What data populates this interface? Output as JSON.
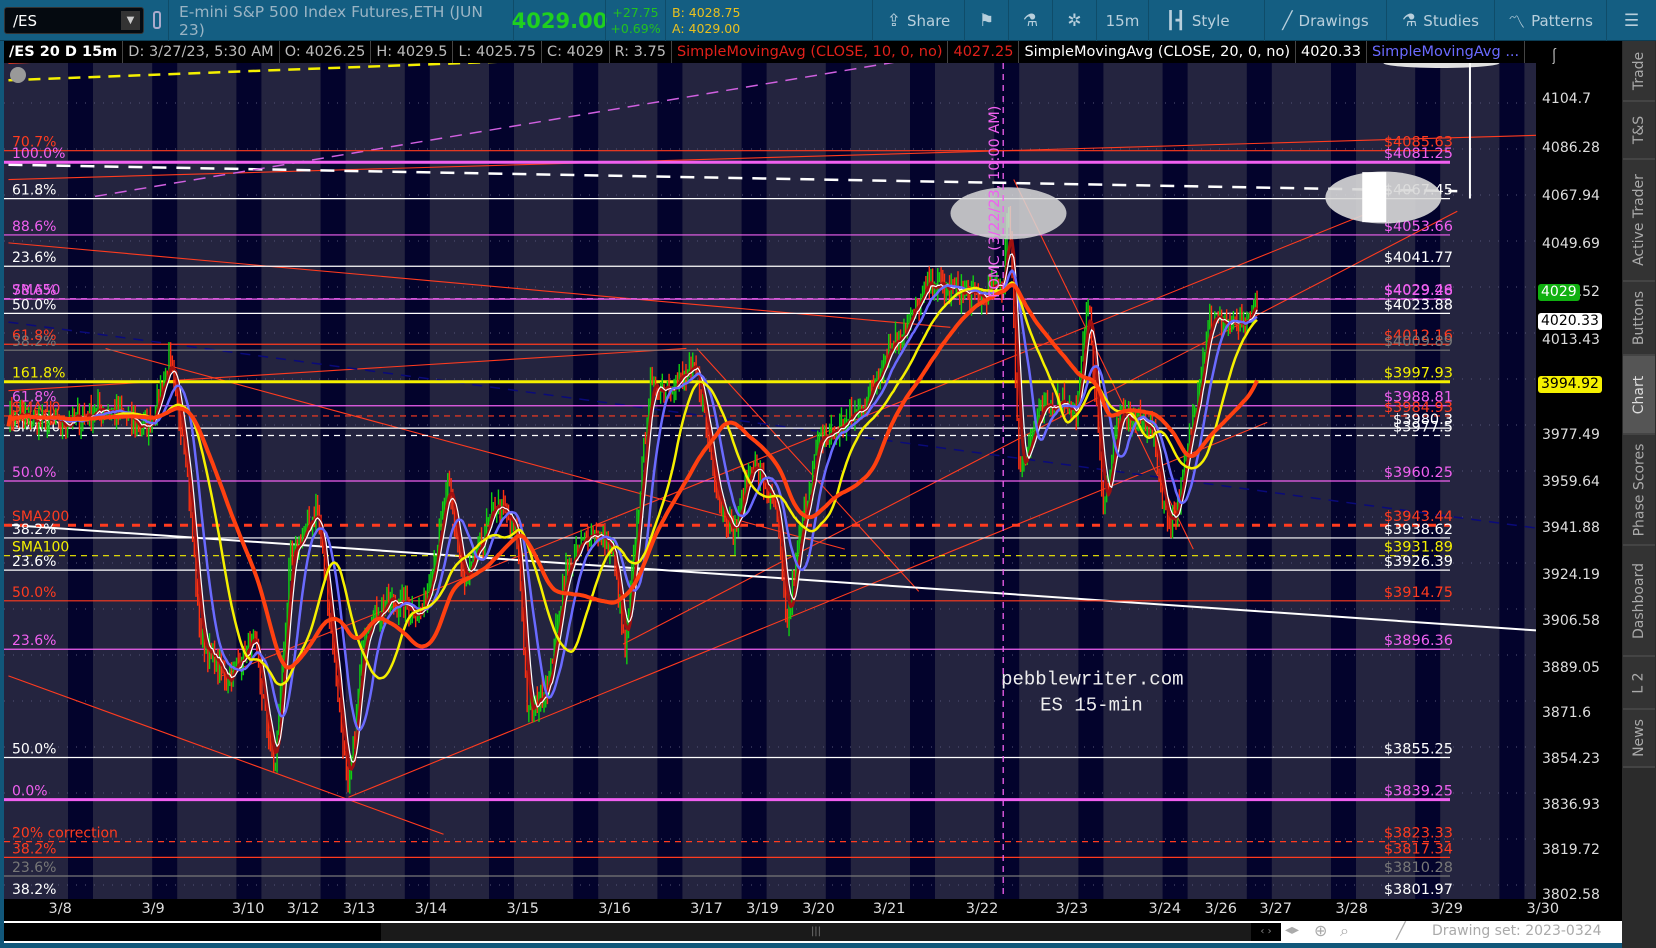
{
  "toolbar": {
    "symbol": "/ES",
    "description": "E-mini S&P 500 Index Futures,ETH (JUN 23)",
    "last": "4029.00",
    "change": "+27.75",
    "change_pct": "+0.69%",
    "bid": "B: 4028.75",
    "ask": "A: 4029.00",
    "buttons": [
      {
        "label": "Share",
        "icon": "share-icon"
      },
      {
        "label": "",
        "icon": "alert-icon"
      },
      {
        "label": "",
        "icon": "flask-icon"
      },
      {
        "label": "",
        "icon": "gear-icon"
      },
      {
        "label": "15m",
        "icon": ""
      },
      {
        "label": "Style",
        "icon": "candle-icon"
      },
      {
        "label": "Drawings",
        "icon": "pencil-line-icon"
      },
      {
        "label": "Studies",
        "icon": "flask-icon"
      },
      {
        "label": "Patterns",
        "icon": "patterns-icon"
      },
      {
        "label": "",
        "icon": "menu-icon"
      }
    ]
  },
  "info": {
    "title": "/ES 20 D 15m",
    "date": "D: 3/27/23, 5:30 AM",
    "open": "O: 4026.25",
    "high": "H: 4029.5",
    "low": "L: 4025.75",
    "close": "C: 4029",
    "range": "R: 3.75",
    "study1": "SimpleMovingAvg (CLOSE, 10, 0, no)",
    "study1_value": "4027.25",
    "study2": "SimpleMovingAvg (CLOSE, 20, 0, no)",
    "study2_value": "4020.33",
    "study3": "SimpleMovingAvg ...",
    "colors": {
      "study1": "#e0201a",
      "study2": "#ffffff",
      "study3": "#6a6aff"
    }
  },
  "levels": [
    {
      "price": 4085.63,
      "left": "70.7%",
      "right": "$4085.63",
      "color": "#ff3b1f",
      "style": "solid"
    },
    {
      "price": 4081.25,
      "left": "100.0%",
      "right": "$4081.25",
      "color": "#f060f0",
      "style": "thick"
    },
    {
      "price": 4067.45,
      "left": "61.8%",
      "right": "$4067.45",
      "color": "#ffffff",
      "style": "solid"
    },
    {
      "price": 4053.66,
      "left": "88.6%",
      "right": "$4053.66",
      "color": "#f060f0",
      "style": "solid"
    },
    {
      "price": 4041.77,
      "left": "23.6%",
      "right": "$4041.77",
      "color": "#ffffff",
      "style": "solid"
    },
    {
      "price": 4029.46,
      "left": "SMA50",
      "right": "$4029.46",
      "color": "#f060f0",
      "style": "dashed"
    },
    {
      "price": 4029.28,
      "left": "78.6%",
      "right": "$4029.28",
      "color": "#f060f0",
      "style": "solid"
    },
    {
      "price": 4023.88,
      "left": "50.0%",
      "right": "$4023.88",
      "color": "#ffffff",
      "style": "solid"
    },
    {
      "price": 4012.16,
      "left": "61.8%",
      "right": "$4012.16",
      "color": "#ff3b1f",
      "style": "solid"
    },
    {
      "price": 4009.89,
      "left": "38.2%",
      "right": "$4009.89",
      "color": "#777777",
      "style": "solid"
    },
    {
      "price": 3997.93,
      "left": "161.8%",
      "right": "$3997.93",
      "color": "#f5f000",
      "style": "thick"
    },
    {
      "price": 3988.81,
      "left": "61.8%",
      "right": "$3988.81",
      "color": "#f060f0",
      "style": "solid"
    },
    {
      "price": 3984.93,
      "left": "SMA10",
      "right": "$3984.93",
      "color": "#ff3b1f",
      "style": "dashed"
    },
    {
      "price": 3980.3,
      "left": "38.2%",
      "right": "$3980.3",
      "color": "#ffffff",
      "style": "solid"
    },
    {
      "price": 3977.5,
      "left": "SMA20",
      "right": "$3977.5",
      "color": "#ffffff",
      "style": "dashed"
    },
    {
      "price": 3960.25,
      "left": "50.0%",
      "right": "$3960.25",
      "color": "#f060f0",
      "style": "solid"
    },
    {
      "price": 3943.44,
      "left": "SMA200",
      "right": "$3943.44",
      "color": "#ff3b1f",
      "style": "thickdash"
    },
    {
      "price": 3938.62,
      "left": "38.2%",
      "right": "$3938.62",
      "color": "#ffffff",
      "style": "solid"
    },
    {
      "price": 3931.89,
      "left": "SMA100",
      "right": "$3931.89",
      "color": "#f5f000",
      "style": "dashed"
    },
    {
      "price": 3926.39,
      "left": "23.6%",
      "right": "$3926.39",
      "color": "#ffffff",
      "style": "solid"
    },
    {
      "price": 3914.75,
      "left": "50.0%",
      "right": "$3914.75",
      "color": "#ff3b1f",
      "style": "solid"
    },
    {
      "price": 3896.36,
      "left": "23.6%",
      "right": "$3896.36",
      "color": "#f060f0",
      "style": "solid"
    },
    {
      "price": 3855.25,
      "left": "50.0%",
      "right": "$3855.25",
      "color": "#ffffff",
      "style": "solid"
    },
    {
      "price": 3839.25,
      "left": "0.0%",
      "right": "$3839.25",
      "color": "#f060f0",
      "style": "thick"
    },
    {
      "price": 3823.33,
      "left": "20% correction",
      "right": "$3823.33",
      "color": "#ff3b1f",
      "style": "dashed"
    },
    {
      "price": 3817.34,
      "left": "38.2%",
      "right": "$3817.34",
      "color": "#ff3b1f",
      "style": "solid"
    },
    {
      "price": 3810.28,
      "left": "23.6%",
      "right": "$3810.28",
      "color": "#777777",
      "style": "solid"
    },
    {
      "price": 3801.97,
      "left": "38.2%",
      "right": "$3801.97",
      "color": "#ffffff",
      "style": "none"
    }
  ],
  "price_axis": {
    "ticks": [
      "4104.7",
      "4086.28",
      "4067.94",
      "4049.69",
      "4031.52",
      "4013.43",
      "3977.49",
      "3959.64",
      "3941.88",
      "3924.19",
      "3906.58",
      "3889.05",
      "3871.6",
      "3854.23",
      "3836.93",
      "3819.72",
      "3802.58"
    ],
    "markers": [
      {
        "value": "4029",
        "bg": "#10b010",
        "fg": "#ffffff"
      },
      {
        "value": "4020.33",
        "bg": "#ffffff",
        "fg": "#000000"
      },
      {
        "value": "3994.92",
        "bg": "#f5f000",
        "fg": "#000000"
      }
    ]
  },
  "date_axis": [
    "3/8",
    "3/9",
    "3/10",
    "3/12",
    "3/13",
    "3/14",
    "3/15",
    "3/16",
    "3/17",
    "3/19",
    "3/20",
    "3/21",
    "3/22",
    "3/23",
    "3/24",
    "3/26",
    "3/27",
    "3/28",
    "3/29",
    "3/30"
  ],
  "annotations": {
    "fomc": "FOMC (3/22/23, 10:00 AM)",
    "watermark1": "pebblewriter.com",
    "watermark2": "ES 15-min"
  },
  "scrollbar": {
    "drawing_set": "Drawing set: 2023-0324"
  },
  "sidebar": [
    "Trade",
    "T&S",
    "Active Trader",
    "Buttons",
    "Chart",
    "Phase Scores",
    "Dashboard",
    "L 2",
    "News"
  ],
  "sidebar_selected": "Chart"
}
